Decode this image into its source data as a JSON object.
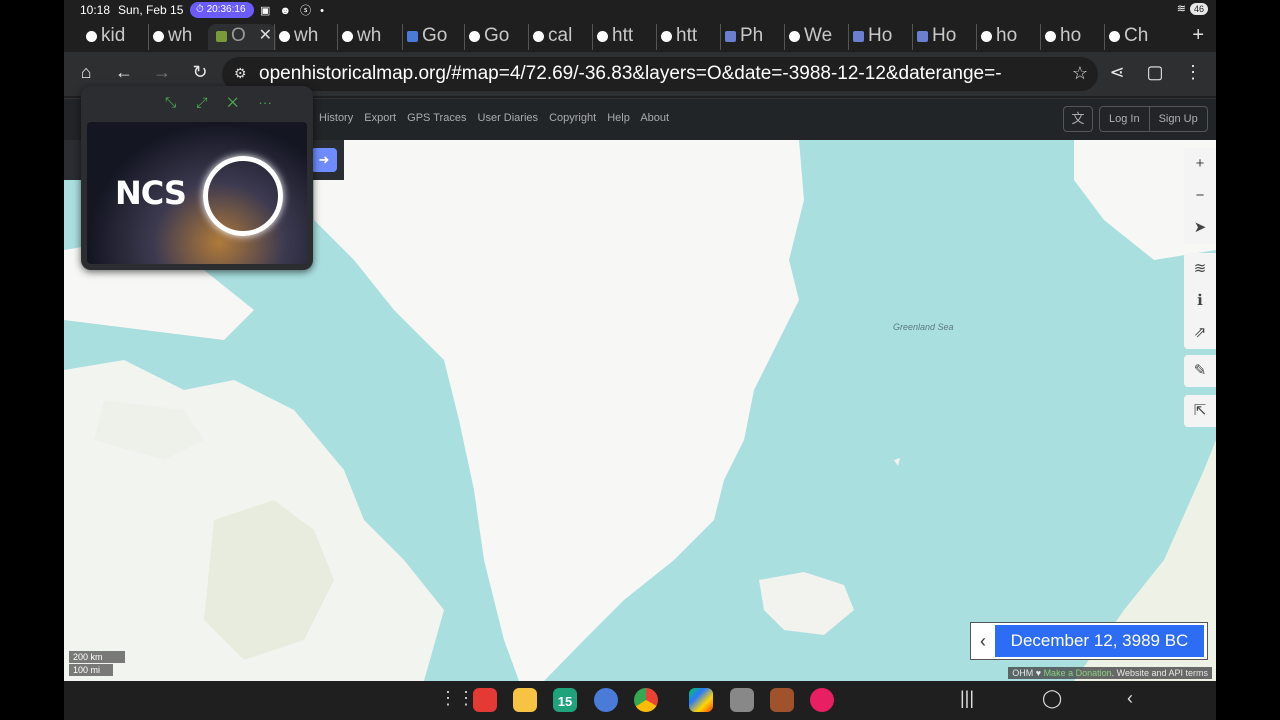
{
  "status": {
    "time": "10:18",
    "date": "Sun, Feb 15",
    "timer": "20:36:16",
    "battery": "46"
  },
  "tabs": [
    {
      "label": "kid"
    },
    {
      "label": "wh"
    },
    {
      "label": "O"
    },
    {
      "label": "wh"
    },
    {
      "label": "wh"
    },
    {
      "label": "Go"
    },
    {
      "label": "Go"
    },
    {
      "label": "cal"
    },
    {
      "label": "htt"
    },
    {
      "label": "htt"
    },
    {
      "label": "Ph"
    },
    {
      "label": "We"
    },
    {
      "label": "Ho"
    },
    {
      "label": "Ho"
    },
    {
      "label": "ho"
    },
    {
      "label": "ho"
    },
    {
      "label": "Ch"
    }
  ],
  "toolbar": {
    "url": "openhistoricalmap.org/#map=4/72.69/-36.83&layers=O&date=-3988-12-12&daterange=-"
  },
  "site": {
    "nav": [
      "History",
      "Export",
      "GPS Traces",
      "User Diaries",
      "Copyright",
      "Help",
      "About"
    ],
    "login": "Log In",
    "signup": "Sign Up"
  },
  "map": {
    "sea_label": "Greenland Sea",
    "scale_km": "200 km",
    "scale_mi": "100 mi",
    "date_label": "December 12, 3989 BC",
    "attribution_prefix": "OHM ♥",
    "attribution_donate": "Make a Donation",
    "attribution_suffix": ". Website and API terms"
  },
  "pip": {
    "logo": "NCS"
  },
  "dock": {
    "calendar_day": "15"
  }
}
